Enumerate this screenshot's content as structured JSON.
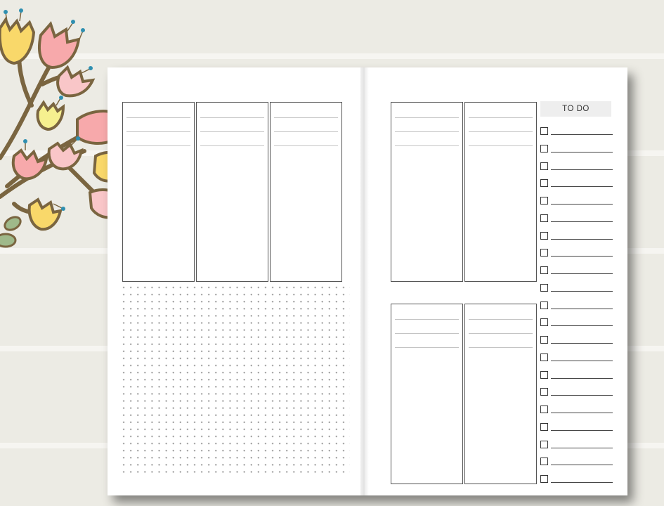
{
  "background": {
    "color": "#ecebe4",
    "stripe_color": "#f6f5f1"
  },
  "floral": {
    "petal_colors": [
      "#f9d86a",
      "#f7a9ab",
      "#f9c6c8",
      "#f6f08f"
    ],
    "stem_color": "#7a6540",
    "pin_color": "#2f8fb0",
    "leaf_color": "#9fb98a"
  },
  "planner": {
    "todo": {
      "title": "TO DO",
      "item_count": 21
    },
    "left_page": {
      "column_count": 3,
      "grid": "dot"
    },
    "right_page": {
      "top_column_count": 2,
      "bottom_column_count": 2
    }
  }
}
